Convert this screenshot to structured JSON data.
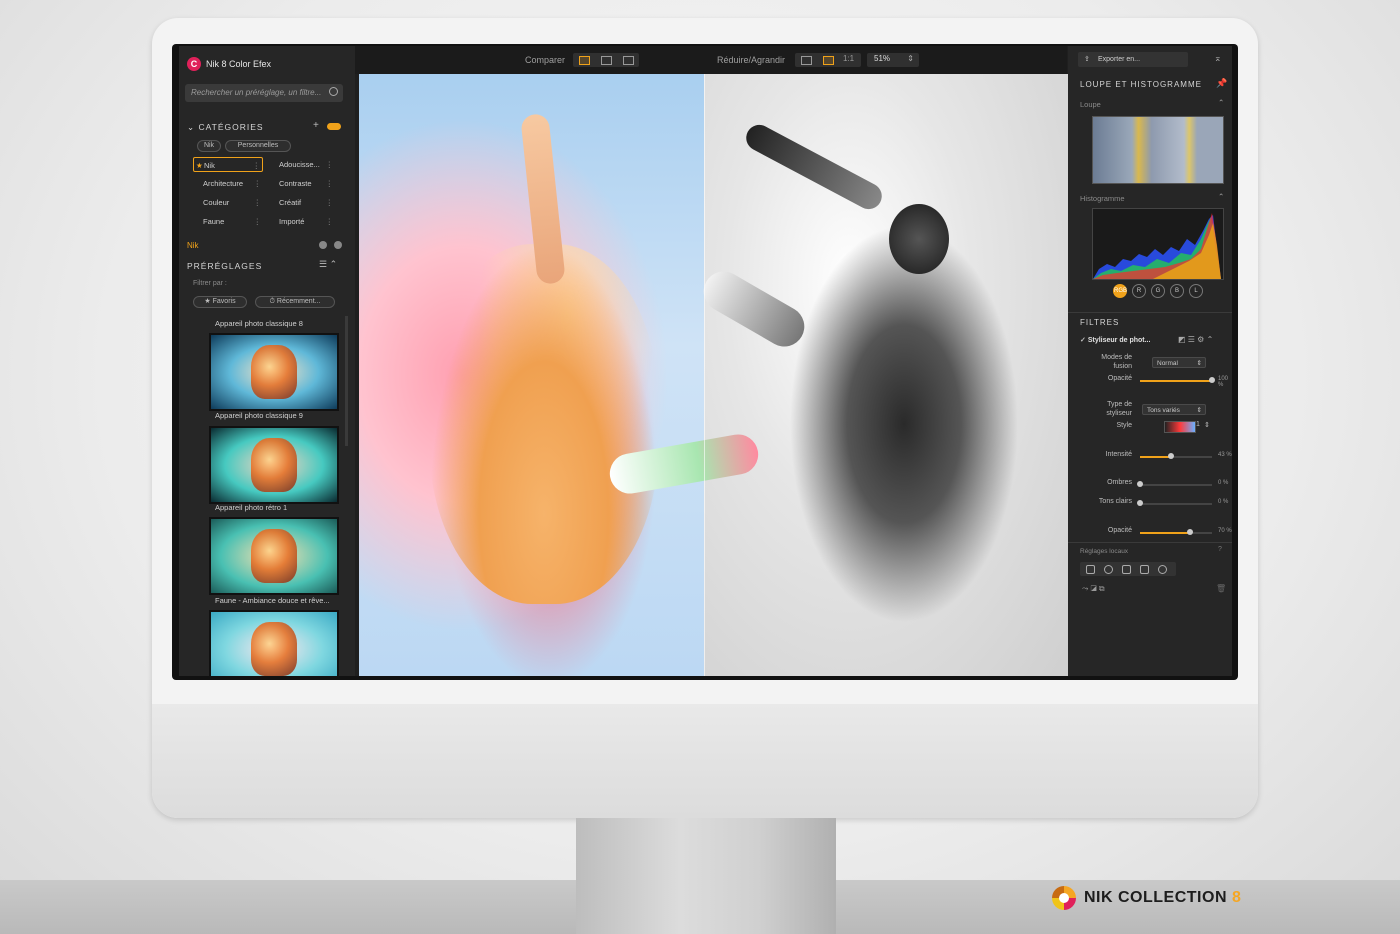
{
  "app": {
    "title": "Nik 8 Color Efex",
    "logo_letter": "C"
  },
  "left": {
    "search_placeholder": "Rechercher un préréglage, un filtre...",
    "categories_title": "CATÉGORIES",
    "tabs": [
      "Nik",
      "Personnelles"
    ],
    "categories": [
      {
        "label": "Nik",
        "selected": true
      },
      {
        "label": "Adoucisse..."
      },
      {
        "label": "Architecture"
      },
      {
        "label": "Contraste"
      },
      {
        "label": "Couleur"
      },
      {
        "label": "Créatif"
      },
      {
        "label": "Faune"
      },
      {
        "label": "Importé"
      }
    ],
    "current_filter": "Nik",
    "presets_title": "PRÉRÉGLAGES",
    "filter_label": "Filtrer par :",
    "filter_buttons": [
      "Favoris",
      "Récemment..."
    ],
    "presets": [
      {
        "label": "Appareil photo classique 8"
      },
      {
        "label": "Appareil photo classique 9"
      },
      {
        "label": "Appareil photo rétro 1"
      },
      {
        "label": "Faune - Ambiance douce et rêve..."
      }
    ]
  },
  "toolbar": {
    "compare_label": "Comparer",
    "zoom_label": "Réduire/Agrandir",
    "one_to_one": "1:1",
    "zoom_value": "51%",
    "export_label": "Exporter en..."
  },
  "right": {
    "loupe_hist_title": "LOUPE ET HISTOGRAMME",
    "loupe_label": "Loupe",
    "hist_label": "Histogramme",
    "channels": [
      "RGB",
      "R",
      "G",
      "B",
      "L"
    ],
    "filters_title": "FILTRES",
    "filter_name": "Styliseur de phot...",
    "blend_label": "Modes de fusion",
    "blend_value": "Normal",
    "opacity_label": "Opacité",
    "opacity_value": "100 %",
    "styliser_type_label": "Type de styliseur",
    "styliser_type_value": "Tons variés",
    "style_label": "Style",
    "style_value": "1",
    "intensity_label": "Intensité",
    "intensity_value": "43 %",
    "shadows_label": "Ombres",
    "shadows_value": "0 %",
    "highlights_label": "Tons clairs",
    "highlights_value": "0 %",
    "opacity2_label": "Opacité",
    "opacity2_value": "70 %",
    "local_adjust_label": "Réglages locaux"
  },
  "sliders": {
    "opacity": 1.0,
    "intensity": 0.43,
    "shadows": 0.0,
    "highlights": 0.0,
    "opacity2": 0.7
  },
  "brand": {
    "name": "NIK COLLECTION",
    "version": "8"
  },
  "colors": {
    "accent": "#f0a21a",
    "logo": "#e0215a"
  }
}
